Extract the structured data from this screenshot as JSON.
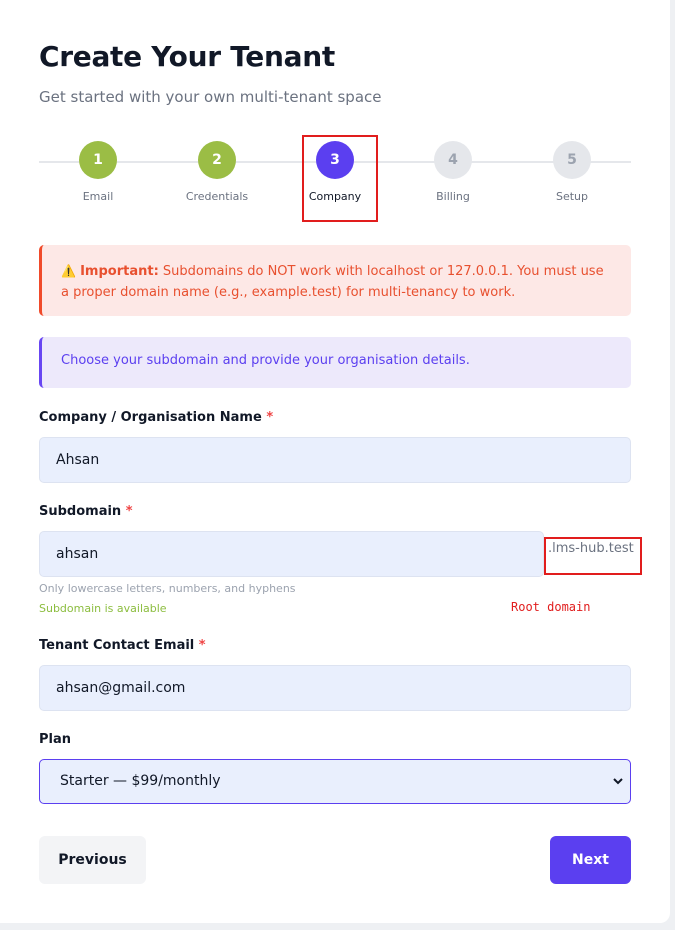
{
  "header": {
    "title": "Create Your Tenant",
    "subtitle": "Get started with your own multi-tenant space"
  },
  "stepper": {
    "current_step": 3,
    "steps": [
      {
        "number": "1",
        "label": "Email",
        "state": "done"
      },
      {
        "number": "2",
        "label": "Credentials",
        "state": "done"
      },
      {
        "number": "3",
        "label": "Company",
        "state": "active"
      },
      {
        "number": "4",
        "label": "Billing",
        "state": "pending"
      },
      {
        "number": "5",
        "label": "Setup",
        "state": "pending"
      }
    ]
  },
  "alerts": {
    "warning_icon": "warning-icon",
    "warning_title": "Important:",
    "warning_text": " Subdomains do NOT work with localhost or 127.0.0.1. You must use a proper domain name (e.g., example.test) for multi-tenancy to work.",
    "info_text": "Choose your subdomain and provide your organisation details."
  },
  "form": {
    "company": {
      "label": "Company / Organisation Name",
      "required_mark": "*",
      "value": "Ahsan"
    },
    "subdomain": {
      "label": "Subdomain",
      "required_mark": "*",
      "value": "ahsan",
      "suffix": ".lms-hub.test",
      "hint": "Only lowercase letters, numbers, and hyphens",
      "status": "Subdomain is available"
    },
    "email": {
      "label": "Tenant Contact Email",
      "required_mark": "*",
      "value": "ahsan@gmail.com"
    },
    "plan": {
      "label": "Plan",
      "selected": "Starter — $99/monthly"
    }
  },
  "annotation": {
    "root_domain_note": "Root domain"
  },
  "actions": {
    "previous": "Previous",
    "next": "Next"
  },
  "colors": {
    "accent": "#5b3ff0",
    "step_done": "#9bbd45",
    "warning": "#e8502f",
    "highlight": "#e11d1d"
  }
}
